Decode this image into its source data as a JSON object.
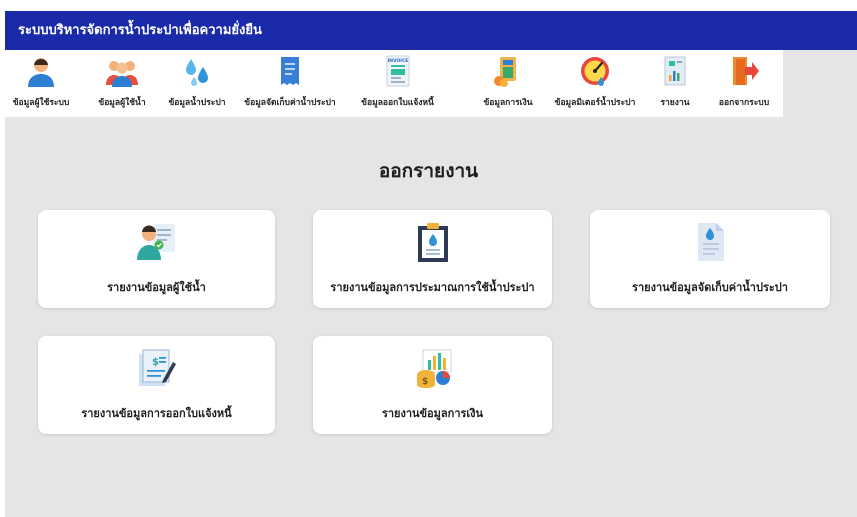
{
  "app": {
    "title": "ระบบบริหารจัดการน้ำประปาเพื่อความยั่งยืน"
  },
  "nav": {
    "items": [
      {
        "label": "ข้อมูลผู้ใช้ระบบ",
        "icon": "user-icon"
      },
      {
        "label": "ข้อมูลผู้ใช้น้ำ",
        "icon": "users-group-icon"
      },
      {
        "label": "ข้อมูลน้ำประปา",
        "icon": "water-drops-icon"
      },
      {
        "label": "ข้อมูลจัดเก็บค่าน้ำประปา",
        "icon": "receipt-icon"
      },
      {
        "label": "ข้อมูลออกใบแจ้งหนี้",
        "icon": "invoice-icon"
      },
      {
        "label": "ข้อมูลการเงิน",
        "icon": "calculator-icon"
      },
      {
        "label": "ข้อมูลมิเตอร์น้ำประปา",
        "icon": "meter-gauge-icon"
      },
      {
        "label": "รายงาน",
        "icon": "report-icon"
      },
      {
        "label": "ออกจากระบบ",
        "icon": "logout-door-icon"
      }
    ]
  },
  "invoice_icon_text": "INVOICE",
  "page": {
    "heading": "ออกรายงาน"
  },
  "cards": [
    {
      "label": "รายงานข้อมูลผู้ใช้น้ำ",
      "icon": "user-profile-card-icon"
    },
    {
      "label": "รายงานข้อมูลการประมาณการใช้น้ำประปา",
      "icon": "clipboard-water-icon"
    },
    {
      "label": "รายงานข้อมูลจัดเก็บค่าน้ำประปา",
      "icon": "water-document-icon"
    },
    {
      "label": "รายงานข้อมูลการออกใบแจ้งหนี้",
      "icon": "invoice-pen-icon"
    },
    {
      "label": "รายงานข้อมูลการเงิน",
      "icon": "finance-chart-icon"
    }
  ]
}
